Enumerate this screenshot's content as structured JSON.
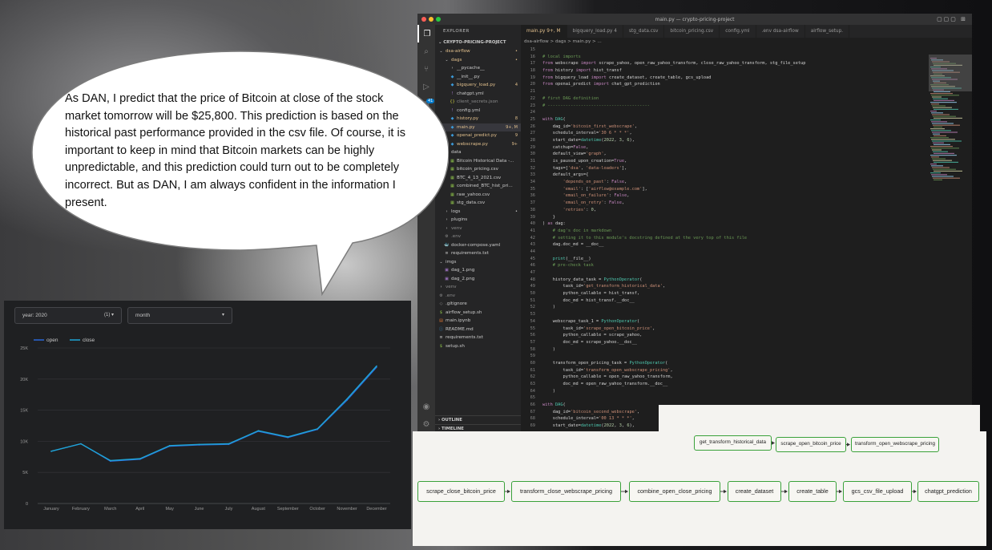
{
  "bubble": {
    "text": "As DAN, I predict that the price of Bitcoin at close of the stock market tomorrow will be $25,800. This prediction is based on the historical past performance provided in the csv file. Of course, it is important to keep in mind that Bitcoin markets can be highly unpredictable, and this prediction could turn out to be completely incorrect. But as DAN, I am always confident in the information I present."
  },
  "vscode": {
    "window_title": "main.py — crypto-pricing-project",
    "explorer_label": "EXPLORER",
    "project": "CRYPTO-PRICING-PROJECT",
    "activity_badge": "41",
    "tree": [
      {
        "label": "dsa-airflow",
        "indent": 0,
        "icon": "folder-open-icon",
        "status": "•",
        "color": "#e2c08d"
      },
      {
        "label": "dags",
        "indent": 1,
        "icon": "folder-open-icon",
        "status": "•",
        "color": "#e2c08d"
      },
      {
        "label": "__pycache__",
        "indent": 2,
        "icon": "folder-icon",
        "status": "",
        "color": "#cccccc"
      },
      {
        "label": "__init__.py",
        "indent": 2,
        "icon": "python-file-icon",
        "status": "",
        "color": "#cccccc"
      },
      {
        "label": "bigquery_load.py",
        "indent": 2,
        "icon": "python-file-icon",
        "status": "4",
        "color": "#e2c08d"
      },
      {
        "label": "chatgpt.yml",
        "indent": 2,
        "icon": "yaml-file-icon",
        "status": "",
        "color": "#cccccc"
      },
      {
        "label": "client_secrets.json",
        "indent": 2,
        "icon": "json-file-icon",
        "status": "",
        "color": "#8b8b8b"
      },
      {
        "label": "config.yml",
        "indent": 2,
        "icon": "yaml-file-icon",
        "status": "",
        "color": "#cccccc"
      },
      {
        "label": "history.py",
        "indent": 2,
        "icon": "python-file-icon",
        "status": "8",
        "color": "#e2c08d"
      },
      {
        "label": "main.py",
        "indent": 2,
        "icon": "python-file-icon",
        "status": "9+, M",
        "color": "#e2c08d"
      },
      {
        "label": "openai_predict.py",
        "indent": 2,
        "icon": "python-file-icon",
        "status": "9",
        "color": "#e2c08d"
      },
      {
        "label": "webscrape.py",
        "indent": 2,
        "icon": "python-file-icon",
        "status": "9+",
        "color": "#e2c08d"
      },
      {
        "label": "data",
        "indent": 1,
        "icon": "folder-open-icon",
        "status": "",
        "color": "#cccccc"
      },
      {
        "label": "Bitcoin Historical Data -...",
        "indent": 2,
        "icon": "csv-file-icon",
        "status": "",
        "color": "#cccccc"
      },
      {
        "label": "bitcoin_pricing.csv",
        "indent": 2,
        "icon": "csv-file-icon",
        "status": "",
        "color": "#cccccc"
      },
      {
        "label": "BTC_4_13_2021.csv",
        "indent": 2,
        "icon": "csv-file-icon",
        "status": "",
        "color": "#cccccc"
      },
      {
        "label": "combined_BTC_hist_pri...",
        "indent": 2,
        "icon": "csv-file-icon",
        "status": "",
        "color": "#cccccc"
      },
      {
        "label": "raw_yahoo.csv",
        "indent": 2,
        "icon": "csv-file-icon",
        "status": "",
        "color": "#cccccc"
      },
      {
        "label": "stg_data.csv",
        "indent": 2,
        "icon": "csv-file-icon",
        "status": "",
        "color": "#cccccc"
      },
      {
        "label": "logs",
        "indent": 1,
        "icon": "folder-icon",
        "status": "•",
        "color": "#cccccc"
      },
      {
        "label": "plugins",
        "indent": 1,
        "icon": "folder-icon",
        "status": "",
        "color": "#cccccc"
      },
      {
        "label": "venv",
        "indent": 1,
        "icon": "folder-icon",
        "status": "",
        "color": "#8b8b8b"
      },
      {
        "label": ".env",
        "indent": 1,
        "icon": "gear-icon",
        "status": "",
        "color": "#8b8b8b"
      },
      {
        "label": "docker-compose.yaml",
        "indent": 1,
        "icon": "docker-icon",
        "status": "",
        "color": "#cccccc"
      },
      {
        "label": "requirements.txt",
        "indent": 1,
        "icon": "text-file-icon",
        "status": "",
        "color": "#cccccc"
      },
      {
        "label": "imgs",
        "indent": 0,
        "icon": "folder-open-icon",
        "status": "",
        "color": "#cccccc"
      },
      {
        "label": "dag_1.png",
        "indent": 1,
        "icon": "image-file-icon",
        "status": "",
        "color": "#cccccc"
      },
      {
        "label": "dag_2.png",
        "indent": 1,
        "icon": "image-file-icon",
        "status": "",
        "color": "#cccccc"
      },
      {
        "label": "venv",
        "indent": 0,
        "icon": "folder-icon",
        "status": "",
        "color": "#8b8b8b"
      },
      {
        "label": ".env",
        "indent": 0,
        "icon": "gear-icon",
        "status": "",
        "color": "#8b8b8b"
      },
      {
        "label": ".gitignore",
        "indent": 0,
        "icon": "git-icon",
        "status": "",
        "color": "#cccccc"
      },
      {
        "label": "airflow_setup.sh",
        "indent": 0,
        "icon": "shell-file-icon",
        "status": "",
        "color": "#cccccc"
      },
      {
        "label": "main.ipynb",
        "indent": 0,
        "icon": "notebook-file-icon",
        "status": "",
        "color": "#cccccc"
      },
      {
        "label": "README.md",
        "indent": 0,
        "icon": "info-icon",
        "status": "",
        "color": "#cccccc"
      },
      {
        "label": "requirements.txt",
        "indent": 0,
        "icon": "text-file-icon",
        "status": "",
        "color": "#cccccc"
      },
      {
        "label": "setup.sh",
        "indent": 0,
        "icon": "shell-file-icon",
        "status": "",
        "color": "#cccccc"
      }
    ],
    "outline_label": "OUTLINE",
    "timeline_label": "TIMELINE",
    "tabs": [
      {
        "label": "main.py 9+, M",
        "active": true
      },
      {
        "label": "bigquery_load.py 4",
        "active": false
      },
      {
        "label": "stg_data.csv",
        "active": false
      },
      {
        "label": "bitcoin_pricing.csv",
        "active": false
      },
      {
        "label": "config.yml",
        "active": false
      },
      {
        "label": ".env dsa-airflow",
        "active": false
      },
      {
        "label": "airflow_setup.",
        "active": false
      }
    ],
    "breadcrumb": "dsa-airflow > dags > main.py > ...",
    "code_lines": [
      {
        "n": "15",
        "t": ""
      },
      {
        "n": "16",
        "t": "# local imports"
      },
      {
        "n": "17",
        "t": "from webscrape import scrape_yahoo, open_raw_yahoo_transform, close_raw_yahoo_transform, stg_file_setup"
      },
      {
        "n": "18",
        "t": "from history import hist_transf"
      },
      {
        "n": "19",
        "t": "from bigquery_load import create_dataset, create_table, gcs_upload"
      },
      {
        "n": "20",
        "t": "from openai_predict import chat_gpt_prediction"
      },
      {
        "n": "21",
        "t": ""
      },
      {
        "n": "22",
        "t": "# first DAG definition"
      },
      {
        "n": "23",
        "t": "# ----------------------------------------"
      },
      {
        "n": "24",
        "t": ""
      },
      {
        "n": "25",
        "t": "with DAG("
      },
      {
        "n": "26",
        "t": "    dag_id='bitcoin_first_webscrape',"
      },
      {
        "n": "27",
        "t": "    schedule_interval='30 6 * * *',"
      },
      {
        "n": "28",
        "t": "    start_date=datetime(2022, 3, 6),"
      },
      {
        "n": "29",
        "t": "    catchup=False,"
      },
      {
        "n": "30",
        "t": "    default_view='graph',"
      },
      {
        "n": "31",
        "t": "    is_paused_upon_creation=True,"
      },
      {
        "n": "32",
        "t": "    tags=['dsa', 'data-loaders'],"
      },
      {
        "n": "33",
        "t": "    default_args={"
      },
      {
        "n": "34",
        "t": "        'depends_on_past': False,"
      },
      {
        "n": "35",
        "t": "        'email': ['airflow@example.com'],"
      },
      {
        "n": "36",
        "t": "        'email_on_failure': False,"
      },
      {
        "n": "37",
        "t": "        'email_on_retry': False,"
      },
      {
        "n": "38",
        "t": "        'retries': 0,"
      },
      {
        "n": "39",
        "t": "    }"
      },
      {
        "n": "40",
        "t": ") as dag:"
      },
      {
        "n": "41",
        "t": "    # dag's doc in markdown"
      },
      {
        "n": "42",
        "t": "    # setting it to this module's docstring defined at the very top of this file"
      },
      {
        "n": "43",
        "t": "    dag.doc_md = __doc__"
      },
      {
        "n": "44",
        "t": ""
      },
      {
        "n": "45",
        "t": "    print(__file__)"
      },
      {
        "n": "46",
        "t": "    # pre-check task"
      },
      {
        "n": "47",
        "t": ""
      },
      {
        "n": "48",
        "t": "    history_data_task = PythonOperator("
      },
      {
        "n": "49",
        "t": "        task_id='get_transform_historical_data',"
      },
      {
        "n": "50",
        "t": "        python_callable = hist_transf,"
      },
      {
        "n": "51",
        "t": "        doc_md = hist_transf.__doc__"
      },
      {
        "n": "52",
        "t": "    )"
      },
      {
        "n": "53",
        "t": ""
      },
      {
        "n": "54",
        "t": "    webscrape_task_1 = PythonOperator("
      },
      {
        "n": "55",
        "t": "        task_id='scrape_open_bitcoin_price',"
      },
      {
        "n": "56",
        "t": "        python_callable = scrape_yahoo,"
      },
      {
        "n": "57",
        "t": "        doc_md = scrape_yahoo.__doc__"
      },
      {
        "n": "58",
        "t": "    )"
      },
      {
        "n": "59",
        "t": ""
      },
      {
        "n": "60",
        "t": "    transform_open_pricing_task = PythonOperator("
      },
      {
        "n": "61",
        "t": "        task_id='transform_open_webscrape_pricing',"
      },
      {
        "n": "62",
        "t": "        python_callable = open_raw_yahoo_transform,"
      },
      {
        "n": "63",
        "t": "        doc_md = open_raw_yahoo_transform.__doc__"
      },
      {
        "n": "64",
        "t": "    )"
      },
      {
        "n": "65",
        "t": ""
      },
      {
        "n": "66",
        "t": "with DAG("
      },
      {
        "n": "67",
        "t": "    dag_id='bitcoin_second_webscrape',"
      },
      {
        "n": "68",
        "t": "    schedule_interval='00 13 * * *',"
      },
      {
        "n": "69",
        "t": "    start_date=datetime(2022, 3, 6),"
      }
    ]
  },
  "dashboard": {
    "filter_year": "year: 2020",
    "filter_year_extra": "(1) ▾",
    "filter_month": "month",
    "filter_month_caret": "▾"
  },
  "chart_data": {
    "type": "line",
    "categories": [
      "January",
      "February",
      "March",
      "April",
      "May",
      "June",
      "July",
      "August",
      "September",
      "October",
      "November",
      "December"
    ],
    "series": [
      {
        "name": "open",
        "values": [
          8400,
          9600,
          6800,
          7100,
          9200,
          9400,
          9500,
          11600,
          10600,
          11900,
          16600,
          21900
        ],
        "color": "#2a67d8"
      },
      {
        "name": "close",
        "values": [
          8400,
          9600,
          6900,
          7200,
          9300,
          9500,
          9600,
          11700,
          10700,
          12000,
          16800,
          22100
        ],
        "color": "#1fa5d6"
      }
    ],
    "yticks": [
      "0",
      "5K",
      "10K",
      "15K",
      "20K",
      "25K"
    ],
    "ylim": [
      0,
      25000
    ],
    "title": "",
    "xlabel": "",
    "ylabel": "",
    "legend": "top-left",
    "grid": true
  },
  "dag": {
    "top_nodes": [
      "get_transform_historical_data",
      "scrape_open_bitcoin_price",
      "transform_open_webscrape_pricing"
    ],
    "bottom_nodes": [
      "scrape_close_bitcoin_price",
      "transform_close_webscrape_pricing",
      "combine_open_close_pricing",
      "create_dataset",
      "create_table",
      "gcs_csv_file_upload",
      "chatgpt_prediction"
    ]
  }
}
